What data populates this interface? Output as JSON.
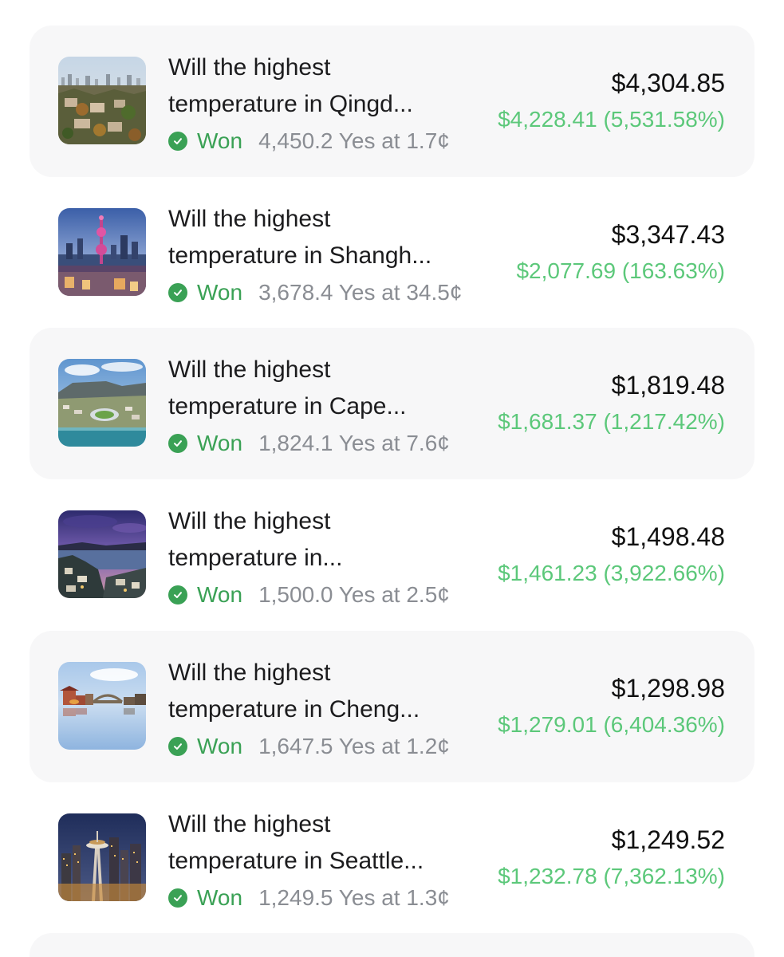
{
  "positions": [
    {
      "title_line1": "Will the highest",
      "title_line2": "temperature in Qingd...",
      "status": "Won",
      "shares": "4,450.2 Yes at 1.7¢",
      "value": "$4,304.85",
      "pnl": "$4,228.41 (5,531.58%)",
      "thumb_icon": "qingdao-city-photo"
    },
    {
      "title_line1": "Will the highest",
      "title_line2": "temperature in Shangh...",
      "status": "Won",
      "shares": "3,678.4 Yes at 34.5¢",
      "value": "$3,347.43",
      "pnl": "$2,077.69 (163.63%)",
      "thumb_icon": "shanghai-skyline-photo"
    },
    {
      "title_line1": "Will the highest",
      "title_line2": "temperature in Cape...",
      "status": "Won",
      "shares": "1,824.1 Yes at 7.6¢",
      "value": "$1,819.48",
      "pnl": "$1,681.37 (1,217.42%)",
      "thumb_icon": "cape-town-photo"
    },
    {
      "title_line1": "Will the highest",
      "title_line2": "temperature in...",
      "status": "Won",
      "shares": "1,500.0 Yes at 2.5¢",
      "value": "$1,498.48",
      "pnl": "$1,461.23 (3,922.66%)",
      "thumb_icon": "harbor-city-dusk-photo"
    },
    {
      "title_line1": "Will the highest",
      "title_line2": "temperature in Cheng...",
      "status": "Won",
      "shares": "1,647.5 Yes at 1.2¢",
      "value": "$1,298.98",
      "pnl": "$1,279.01 (6,404.36%)",
      "thumb_icon": "chengdu-river-photo"
    },
    {
      "title_line1": "Will the highest",
      "title_line2": "temperature in Seattle...",
      "status": "Won",
      "shares": "1,249.5 Yes at 1.3¢",
      "value": "$1,249.52",
      "pnl": "$1,232.78 (7,362.13%)",
      "thumb_icon": "seattle-space-needle-photo"
    }
  ],
  "colors": {
    "won_green": "#3aa155",
    "pnl_green": "#5cc87a",
    "muted_gray": "#8a8d93",
    "card_bg": "#f7f7f8"
  }
}
